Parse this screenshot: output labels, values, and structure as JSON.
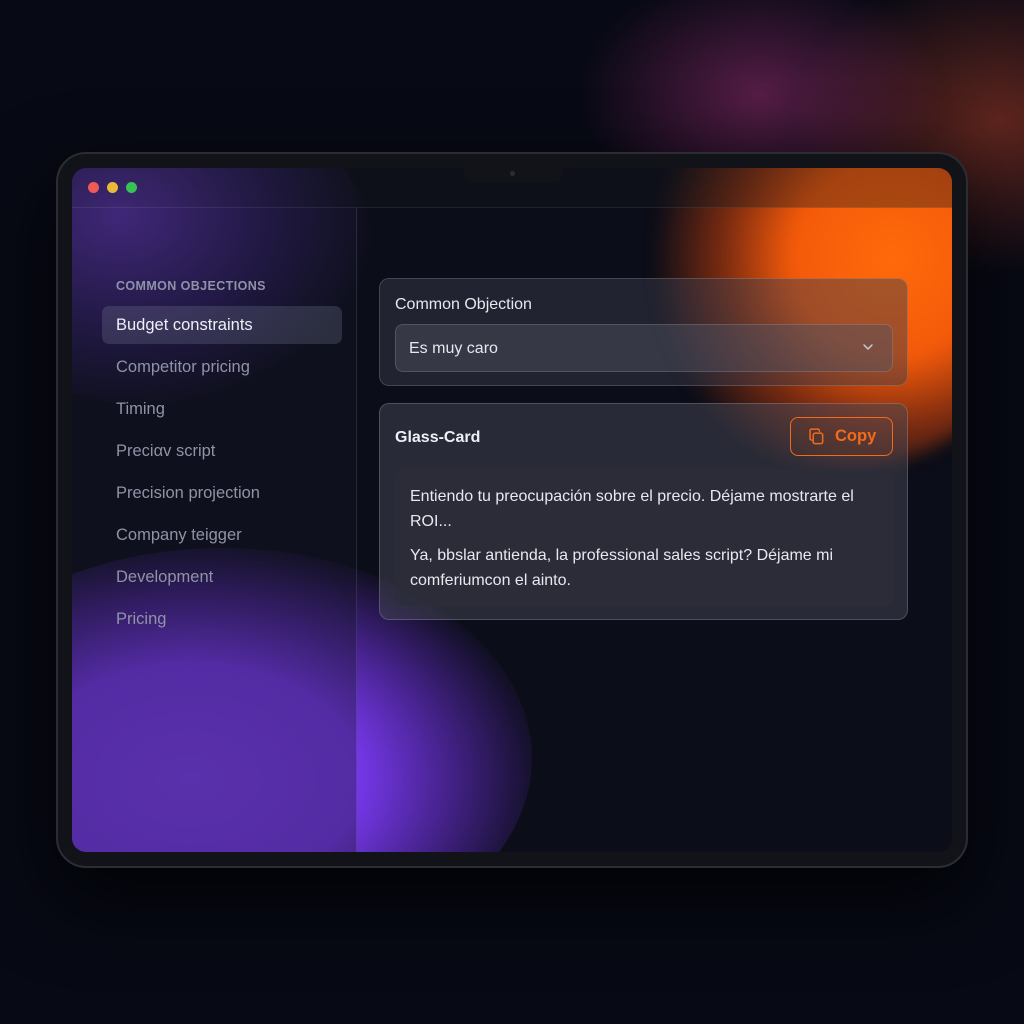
{
  "window": {
    "controls": [
      "close",
      "minimize",
      "maximize"
    ]
  },
  "sidebar": {
    "section_label": "COMMON OBJECTIONS",
    "items": [
      {
        "label": "Budget constraints",
        "active": true
      },
      {
        "label": "Competitor pricing",
        "active": false
      },
      {
        "label": "Timing",
        "active": false
      },
      {
        "label": "Preciαv script",
        "active": false
      },
      {
        "label": "Precision projection",
        "active": false
      },
      {
        "label": "Company teigger",
        "active": false
      },
      {
        "label": "Development",
        "active": false
      },
      {
        "label": "Pricing",
        "active": false
      }
    ]
  },
  "objection": {
    "label": "Common Objection",
    "selected_value": "Es muy caro",
    "dropdown_icon": "chevron-down-icon"
  },
  "glass_card": {
    "title": "Glass-Card",
    "copy_label": "Copy",
    "copy_icon": "copy-icon",
    "paragraphs": [
      "Entiendo tu preocupación sobre el precio. Déjame mostrarte el ROI...",
      "Ya, bbslar antienda, la professional sales script? Déjame mi comferiumcon el ainto."
    ]
  },
  "colors": {
    "accent_orange": "#f26a1b",
    "accent_purple": "#7e3ff2",
    "window_close": "#ee5a55",
    "window_minimize": "#e9b93a",
    "window_maximize": "#37c254"
  }
}
